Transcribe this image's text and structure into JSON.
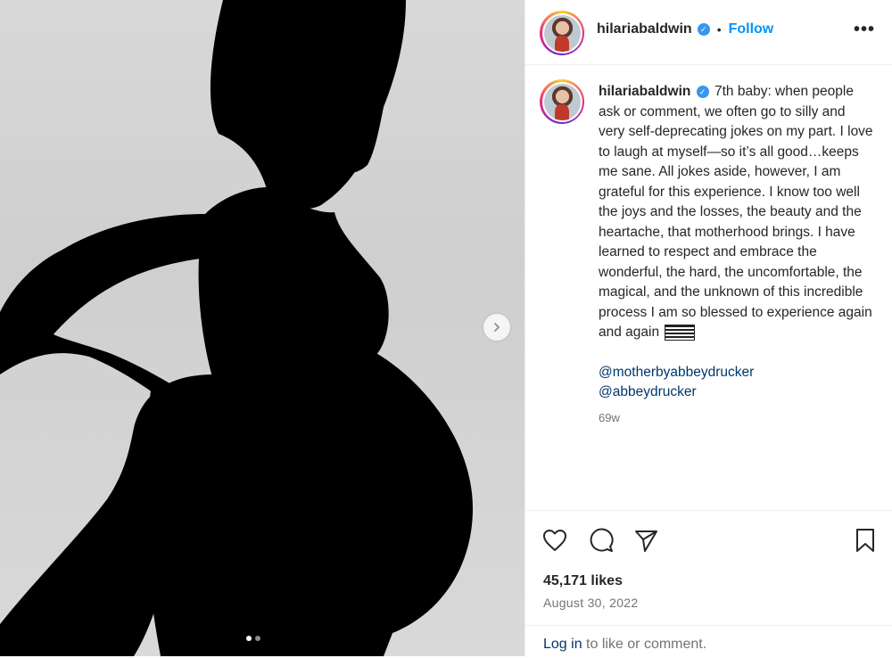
{
  "post": {
    "username": "hilariabaldwin",
    "follow_label": "Follow",
    "separator": "•",
    "more_label": "•••",
    "caption_text": "7th baby: when people ask or comment, we often go to silly and very self-deprecating jokes on my part. I love to laugh at myself—so it’s all good…keeps me sane. All jokes aside, however, I am grateful for this experience. I know too well the joys and the losses, the beauty and the heartache, that motherhood brings. I have learned to respect and embrace the wonderful, the hard, the uncomfortable, the magical, and the unknown of this incredible process I am so blessed to experience again and again",
    "mentions": [
      "@motherbyabbeydrucker",
      "@abbeydrucker"
    ],
    "time_ago": "69w",
    "likes": "45,171 likes",
    "date": "August 30, 2022",
    "login_link": "Log in",
    "login_rest": " to like or comment."
  },
  "media": {
    "slide_count": 2,
    "current_slide": 1
  },
  "icons": {
    "verified": "verified-badge-icon",
    "like": "heart-icon",
    "comment": "comment-icon",
    "share": "send-icon",
    "save": "bookmark-icon",
    "next": "chevron-right-icon"
  },
  "colors": {
    "link_blue": "#0095f6",
    "mention_blue": "#00376b",
    "verified_blue": "#3897f0",
    "muted_text": "#737373"
  }
}
